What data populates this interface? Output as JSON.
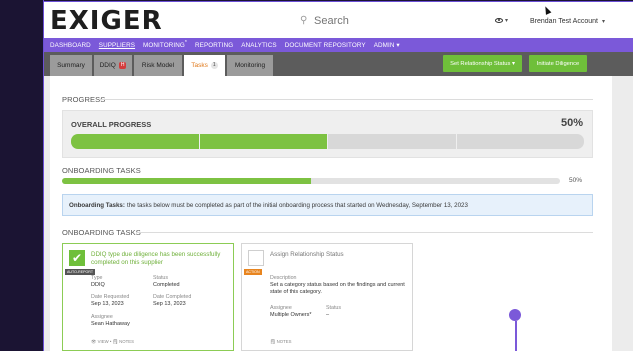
{
  "app": {
    "logo": "EXIGER"
  },
  "header": {
    "search_placeholder": "Search",
    "account_name": "Brendan Test Account"
  },
  "nav": {
    "items": [
      {
        "label": "DASHBOARD"
      },
      {
        "label": "SUPPLIERS"
      },
      {
        "label": "MONITORING",
        "badge": "*"
      },
      {
        "label": "REPORTING"
      },
      {
        "label": "ANALYTICS"
      },
      {
        "label": "DOCUMENT REPOSITORY"
      },
      {
        "label": "ADMIN",
        "caret": "▾"
      }
    ]
  },
  "tabs": {
    "summary": "Summary",
    "ddiq": "DDIQ",
    "ddiq_badge": "H",
    "risk_model": "Risk Model",
    "tasks": "Tasks",
    "tasks_count": "1",
    "monitoring": "Monitoring"
  },
  "actions": {
    "set_status": "Set Relationship Status ▾",
    "initiate": "Initiate Diligence"
  },
  "progress": {
    "section_label": "PROGRESS",
    "overall_title": "OVERALL PROGRESS",
    "overall_pct": "50%",
    "overall_value": 0.5,
    "segments_total": 4,
    "segments_done": 2
  },
  "onboarding": {
    "section_label": "ONBOARDING TASKS",
    "pct": "50%",
    "value": 0.5,
    "info_bold": "Onboarding Tasks:",
    "info_text": "the tasks below must be completed as part of the initial onboarding process that started on Wednesday, September 13, 2023",
    "tasks_label": "ONBOARDING TASKS"
  },
  "cards": [
    {
      "badge": "AUTO-REPORT",
      "badge_color": "#555555",
      "title": "DDIQ type due diligence has been successfully completed on this supplier",
      "type_label": "Type",
      "type_value": "DDIQ",
      "status_label": "Status",
      "status_value": "Completed",
      "requested_label": "Date Requested",
      "requested_value": "Sep 13, 2023",
      "completed_label": "Date Completed",
      "completed_value": "Sep 13, 2023",
      "assignee_label": "Assignee",
      "assignee_value": "Sean Hathaway",
      "footer": "👁 VIEW  •  🗒 NOTES"
    },
    {
      "badge": "ACTION",
      "badge_color": "#e8851f",
      "title": "Assign Relationship Status",
      "desc_label": "Description",
      "desc_value": "Set a category status based on the findings and current state of this category.",
      "assignee_label": "Assignee",
      "assignee_value": "Multiple Owners*",
      "status_label": "Status",
      "status_value": "–",
      "footer": "🗒 NOTES"
    }
  ],
  "colors": {
    "accent": "#7b59d9",
    "green": "#7dc242",
    "tab_active_text": "#e07a1c"
  }
}
